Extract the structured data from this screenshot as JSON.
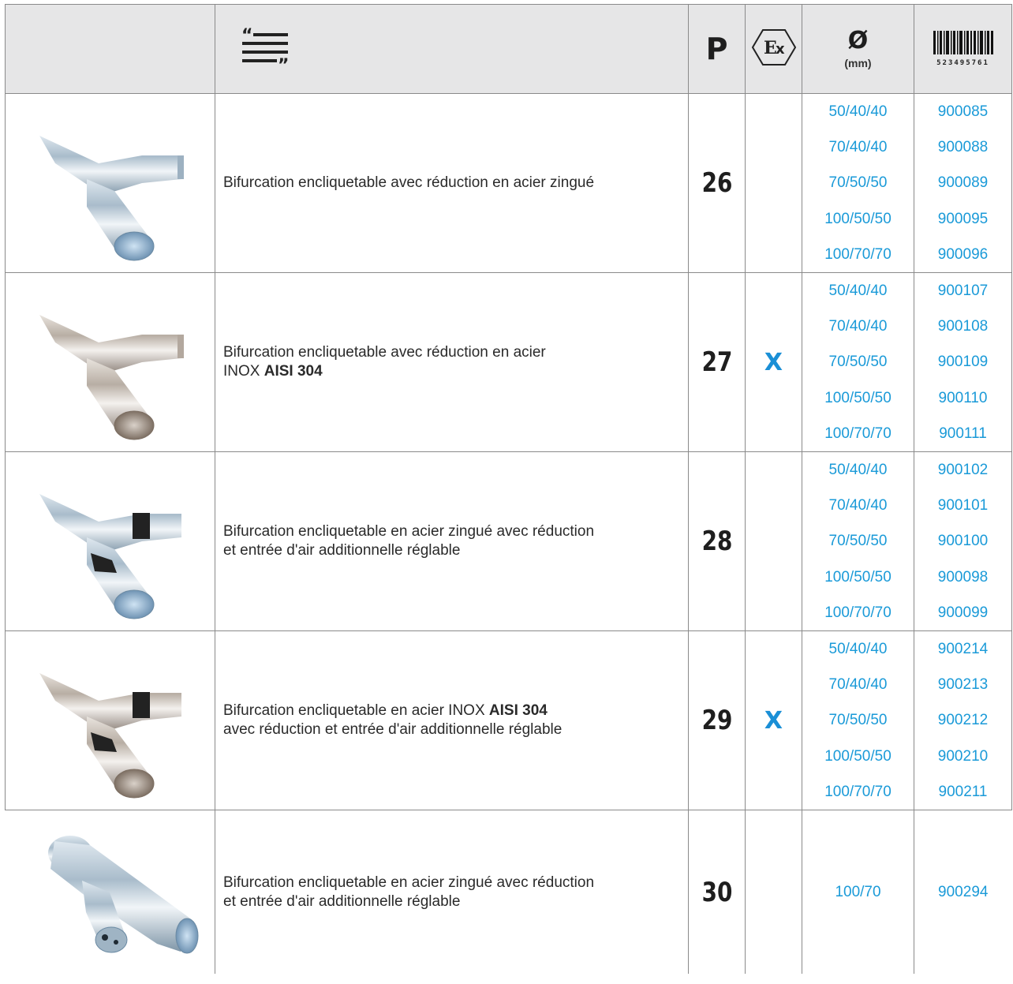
{
  "header": {
    "page_label": "P",
    "ex_icon": "atex-ex-icon",
    "description_icon": "text-lines-quote-icon",
    "diameter_symbol": "Ø",
    "diameter_unit": "(mm)",
    "barcode_icon": "barcode-icon",
    "barcode_digits": "523495761"
  },
  "colors": {
    "accent": "#1a9ad8",
    "header_bg": "#e6e6e7",
    "border": "#8a8a8a"
  },
  "rows": [
    {
      "image": "zinc-plated-branch-icon",
      "desc_line1": "Bifurcation encliquetable avec réduction en acier zingué",
      "desc_line2": "",
      "desc_line2_bold": "",
      "desc_line3": "",
      "page": "26",
      "ex": "",
      "diameters": [
        "50/40/40",
        "70/40/40",
        "70/50/50",
        "100/50/50",
        "100/70/70"
      ],
      "codes": [
        "900085",
        "900088",
        "900089",
        "900095",
        "900096"
      ]
    },
    {
      "image": "stainless-branch-icon",
      "desc_line1": "Bifurcation encliquetable avec réduction en acier",
      "desc_line2": "INOX ",
      "desc_line2_bold": "AISI 304",
      "desc_line3": "",
      "page": "27",
      "ex": "X",
      "diameters": [
        "50/40/40",
        "70/40/40",
        "70/50/50",
        "100/50/50",
        "100/70/70"
      ],
      "codes": [
        "900107",
        "900108",
        "900109",
        "900110",
        "900111"
      ]
    },
    {
      "image": "zinc-plated-branch-air-inlet-icon",
      "desc_line1": "Bifurcation encliquetable en acier zingué avec réduction",
      "desc_line2": "et entrée d'air additionnelle réglable",
      "desc_line2_bold": "",
      "desc_line3": "",
      "page": "28",
      "ex": "",
      "diameters": [
        "50/40/40",
        "70/40/40",
        "70/50/50",
        "100/50/50",
        "100/70/70"
      ],
      "codes": [
        "900102",
        "900101",
        "900100",
        "900098",
        "900099"
      ]
    },
    {
      "image": "stainless-branch-air-inlet-icon",
      "desc_line1": "Bifurcation encliquetable en acier INOX ",
      "desc_line1_bold": "AISI 304",
      "desc_line2": "avec réduction et entrée d'air additionnelle réglable",
      "desc_line2_bold": "",
      "desc_line3": "",
      "page": "29",
      "ex": "X",
      "diameters": [
        "50/40/40",
        "70/40/40",
        "70/50/50",
        "100/50/50",
        "100/70/70"
      ],
      "codes": [
        "900214",
        "900213",
        "900212",
        "900210",
        "900211"
      ]
    },
    {
      "image": "zinc-plated-branch-large-icon",
      "desc_line1": "Bifurcation encliquetable en acier zingué avec réduction",
      "desc_line2": "et entrée d'air additionnelle réglable",
      "desc_line2_bold": "",
      "desc_line3": "",
      "page": "30",
      "ex": "",
      "diameters": [
        "100/70"
      ],
      "codes": [
        "900294"
      ]
    }
  ]
}
